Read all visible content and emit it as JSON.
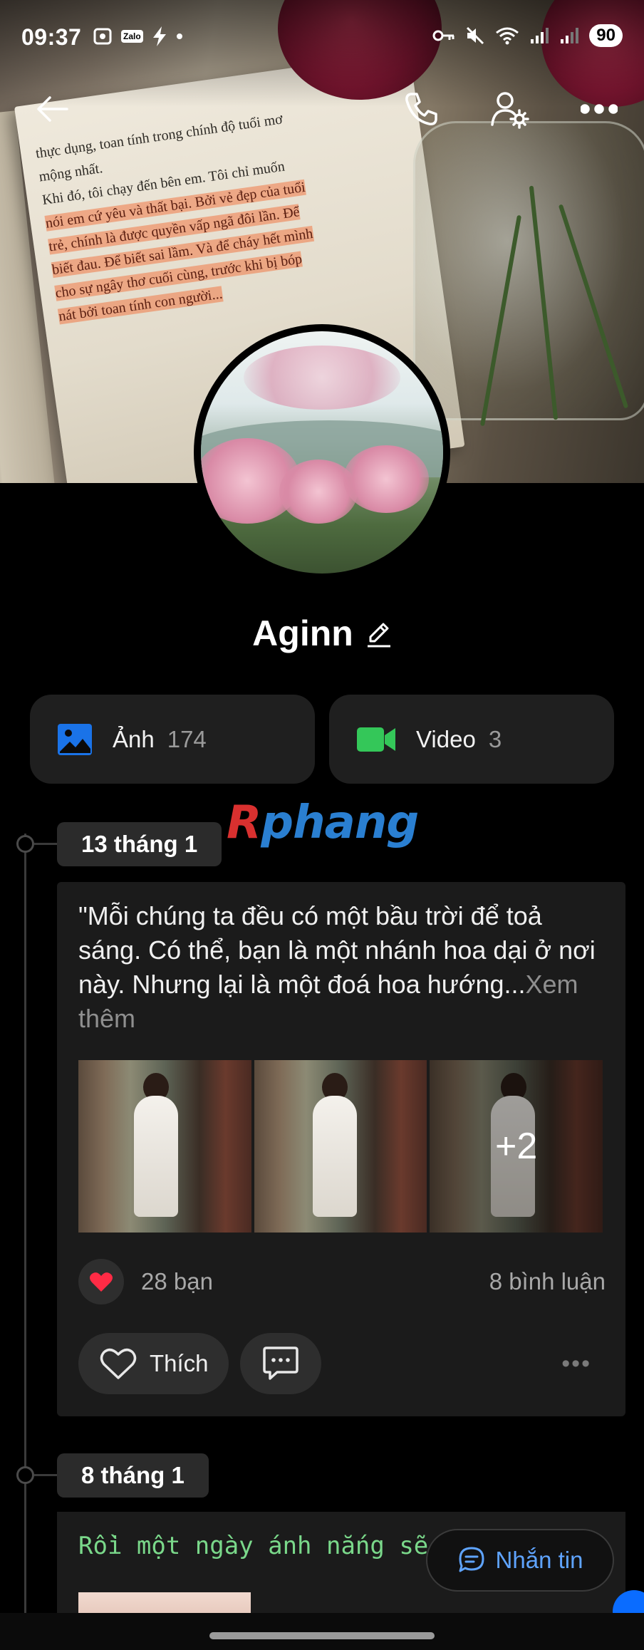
{
  "status_bar": {
    "time": "09:37",
    "app_badge": "Zalo",
    "battery": "90"
  },
  "toolbar": {
    "back_icon": "arrow-left-icon",
    "call_icon": "phone-icon",
    "settings_icon": "user-settings-icon",
    "more_icon": "more-horizontal-icon"
  },
  "cover": {
    "book_lines": [
      {
        "text": "thực dụng, toan tính trong chính độ tuổi mơ",
        "hl": false
      },
      {
        "text": "mộng nhất.",
        "hl": false
      },
      {
        "text": "    Khi đó, tôi chạy đến bên em. Tôi chỉ muốn",
        "hl": false
      },
      {
        "text": "nói em cứ yêu và thất bại. Bởi vẻ đẹp của tuổi",
        "hl": true
      },
      {
        "text": "trẻ, chính là được quyền vấp ngã đôi lần. Để",
        "hl": true
      },
      {
        "text": "biết đau. Để biết sai lầm. Và để cháy hết mình",
        "hl": true
      },
      {
        "text": "cho sự ngây thơ cuối cùng, trước khi bị bóp",
        "hl": true
      },
      {
        "text": "nát bởi toan tính con người...",
        "hl": true
      }
    ]
  },
  "profile": {
    "name": "Aginn",
    "edit_icon": "pencil-icon"
  },
  "media": {
    "photos": {
      "label": "Ảnh",
      "count": "174",
      "icon": "image-icon",
      "color": "#1a73e8"
    },
    "videos": {
      "label": "Video",
      "count": "3",
      "icon": "video-icon",
      "color": "#34c759"
    }
  },
  "watermark": {
    "r": "R",
    "rest": "phang"
  },
  "timeline": [
    {
      "date": "13 tháng 1",
      "text": "\"Mỗi chúng ta đều có một bầu trời để toả sáng. Có thể, bạn là một nhánh hoa dại ở nơi này. Nhưng lại là một đoá hoa hướng...",
      "see_more": "Xem thêm",
      "extra_images": "+2",
      "reaction_icon": "heart-icon",
      "reaction_count": "28 bạn",
      "comment_count": "8 bình luận",
      "like_label": "Thích",
      "more_label": "•••"
    },
    {
      "date": "8 tháng 1",
      "text": "Rồi một ngày ánh nắng sẽ"
    }
  ],
  "message_button": {
    "label": "Nhắn tin",
    "icon": "chat-icon"
  }
}
